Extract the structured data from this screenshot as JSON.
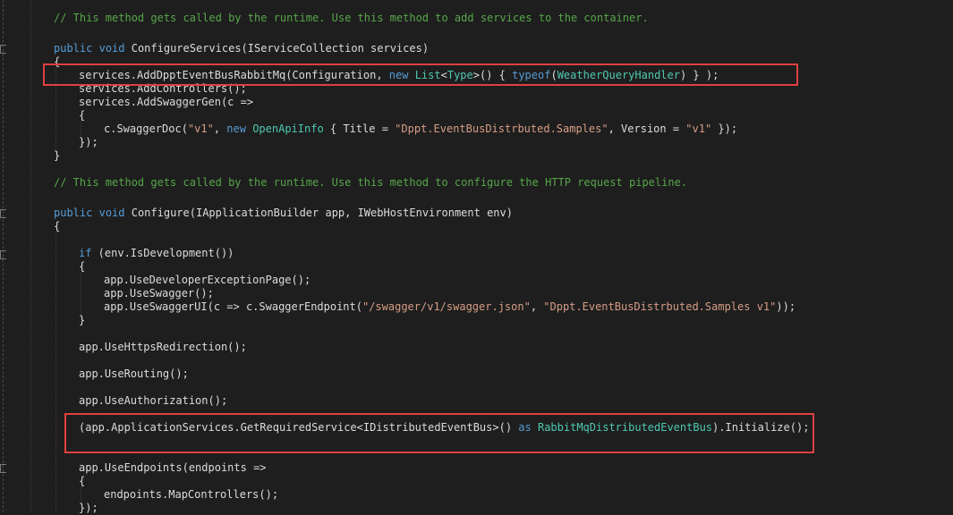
{
  "colors": {
    "background": "#1e1e1e",
    "comment": "#57a64a",
    "keyword": "#569cd6",
    "type": "#4ec9b0",
    "string": "#d69d85",
    "plain": "#dcdcdc",
    "highlight_box": "#e04040"
  },
  "code": {
    "l1": "// This method gets called by the runtime. Use this method to add services to the container.",
    "l2_kw1": "public",
    "l2_kw2": "void",
    "l2_rest": " ConfigureServices(IServiceCollection services)",
    "l3": "{",
    "l4_a": "services.AddDpptEventBusRabbitMq(Configuration, ",
    "l4_new": "new",
    "l4_b": " ",
    "l4_list": "List",
    "l4_c": "<",
    "l4_type": "Type",
    "l4_d": ">() { ",
    "l4_typeof": "typeof",
    "l4_e": "(",
    "l4_handler": "WeatherQueryHandler",
    "l4_f": ") } );",
    "l5": "services.AddControllers();",
    "l6": "services.AddSwaggerGen(c =>",
    "l7": "{",
    "l8_a": "c.SwaggerDoc(",
    "l8_v1": "\"v1\"",
    "l8_b": ", ",
    "l8_new": "new",
    "l8_c": " ",
    "l8_oai": "OpenApiInfo",
    "l8_d": " { Title = ",
    "l8_title": "\"Dppt.EventBusDistrbuted.Samples\"",
    "l8_e": ", Version = ",
    "l8_v1b": "\"v1\"",
    "l8_f": " });",
    "l9": "});",
    "l10": "}",
    "l11": "// This method gets called by the runtime. Use this method to configure the HTTP request pipeline.",
    "l12_kw1": "public",
    "l12_kw2": "void",
    "l12_rest": " Configure(IApplicationBuilder app, IWebHostEnvironment env)",
    "l13": "{",
    "l14_if": "if",
    "l14_rest": " (env.IsDevelopment())",
    "l15": "{",
    "l16": "app.UseDeveloperExceptionPage();",
    "l17": "app.UseSwagger();",
    "l18_a": "app.UseSwaggerUI(c => c.SwaggerEndpoint(",
    "l18_s1": "\"/swagger/v1/swagger.json\"",
    "l18_b": ", ",
    "l18_s2": "\"Dppt.EventBusDistrbuted.Samples v1\"",
    "l18_c": "));",
    "l19": "}",
    "l20": "app.UseHttpsRedirection();",
    "l21": "app.UseRouting();",
    "l22": "app.UseAuthorization();",
    "l23_a": "(app.ApplicationServices.GetRequiredService<IDistributedEventBus>() ",
    "l23_as": "as",
    "l23_b": " ",
    "l23_type": "RabbitMqDistributedEventBus",
    "l23_c": ").Initialize();",
    "l24": "app.UseEndpoints(endpoints =>",
    "l25": "{",
    "l26": "endpoints.MapControllers();",
    "l27": "});"
  }
}
